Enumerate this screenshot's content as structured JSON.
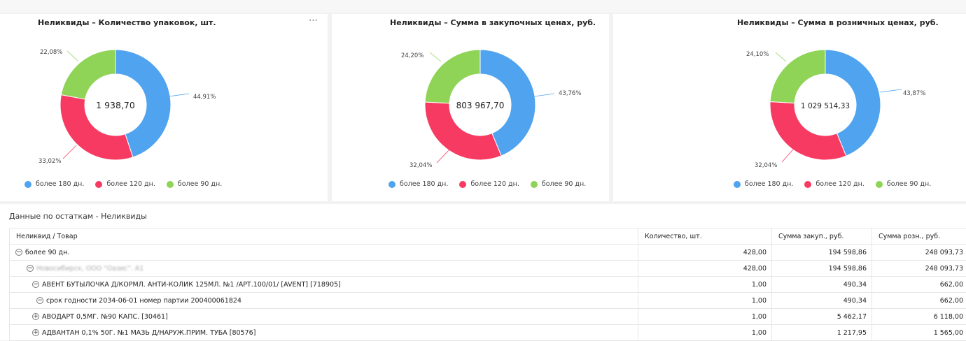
{
  "colors": {
    "more_180": "#4fa3ef",
    "more_120": "#f73a62",
    "more_90": "#8fd357"
  },
  "legend": [
    "более 180 дн.",
    "более 120 дн.",
    "более 90 дн."
  ],
  "charts": [
    {
      "title": "Неликвиды – Количество упаковок, шт.",
      "total": "1 938,70",
      "labels": {
        "blue": "44,91%",
        "red": "33,02%",
        "green": "22,08%"
      },
      "more_icon": "⋯"
    },
    {
      "title": "Неликвиды – Сумма в закупочных ценах, руб.",
      "total": "803 967,70",
      "labels": {
        "blue": "43,76%",
        "red": "32,04%",
        "green": "24,20%"
      }
    },
    {
      "title": "Неликвиды – Сумма в розничных ценах, руб.",
      "total": "1 029 514,33",
      "labels": {
        "blue": "43,87%",
        "red": "32,04%",
        "green": "24,10%"
      }
    }
  ],
  "chart_data": [
    {
      "type": "pie",
      "title": "Неликвиды – Количество упаковок, шт.",
      "categories": [
        "более 180 дн.",
        "более 120 дн.",
        "более 90 дн."
      ],
      "values": [
        44.91,
        33.02,
        22.08
      ],
      "center_label": "1 938,70",
      "legend_position": "bottom-left"
    },
    {
      "type": "pie",
      "title": "Неликвиды – Сумма в закупочных ценах, руб.",
      "categories": [
        "более 180 дн.",
        "более 120 дн.",
        "более 90 дн."
      ],
      "values": [
        43.76,
        32.04,
        24.2
      ],
      "center_label": "803 967,70",
      "legend_position": "bottom-left"
    },
    {
      "type": "pie",
      "title": "Неликвиды – Сумма в розничных ценах, руб.",
      "categories": [
        "более 180 дн.",
        "более 120 дн.",
        "более 90 дн."
      ],
      "values": [
        43.87,
        32.04,
        24.1
      ],
      "center_label": "1 029 514,33",
      "legend_position": "bottom-left"
    }
  ],
  "table": {
    "title": "Данные по остаткам - Неликвиды",
    "headers": [
      "Неликвид / Товар",
      "Количество, шт.",
      "Сумма закуп., руб.",
      "Сумма розн., руб."
    ],
    "rows": [
      {
        "label": "более 90 дн.",
        "qty": "428,00",
        "purchase": "194 598,86",
        "retail": "248 093,73",
        "level": 0,
        "toggle": "−"
      },
      {
        "label": "Новосибирск, ООО \"Оазис\". А1",
        "qty": "428,00",
        "purchase": "194 598,86",
        "retail": "248 093,73",
        "level": 1,
        "toggle": "−"
      },
      {
        "label": "АВЕНТ БУТЫЛОЧКА Д/КОРМЛ. АНТИ-КОЛИК 125МЛ. №1 /АРТ.100/01/ [AVENT] [718905]",
        "qty": "1,00",
        "purchase": "490,34",
        "retail": "662,00",
        "level": 2,
        "toggle": "−"
      },
      {
        "label": "срок годности 2034-06-01 номер партии 200400061824",
        "qty": "1,00",
        "purchase": "490,34",
        "retail": "662,00",
        "level": 3,
        "toggle": "−"
      },
      {
        "label": "АВОДАРТ 0,5МГ. №90 КАПС. [30461]",
        "qty": "1,00",
        "purchase": "5 462,17",
        "retail": "6 118,00",
        "level": 2,
        "toggle": "+"
      },
      {
        "label": "АДВАНТАН 0,1% 50Г. №1 МАЗЬ Д/НАРУЖ.ПРИМ. ТУБА [80576]",
        "qty": "1,00",
        "purchase": "1 217,95",
        "retail": "1 565,00",
        "level": 2,
        "toggle": "+"
      }
    ]
  }
}
